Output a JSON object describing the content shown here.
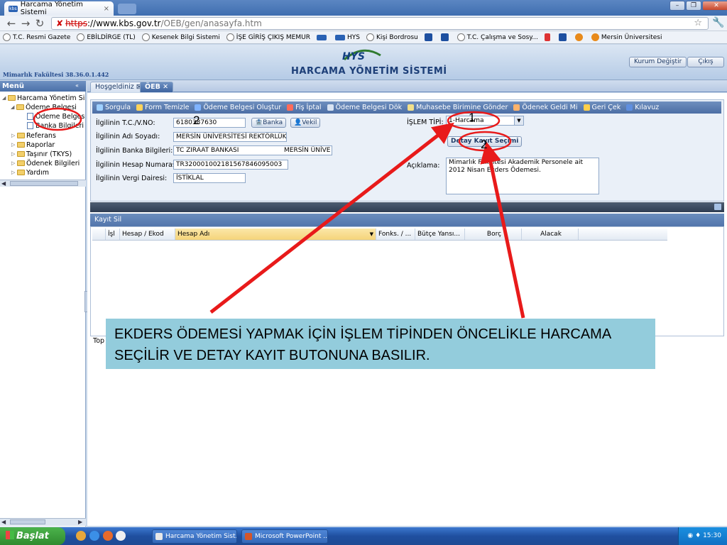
{
  "browser": {
    "tab_title": "Harcama Yönetim Sistemi",
    "tab_favicon": "kbs-favicon",
    "url_scheme": "https",
    "url_separator": "://",
    "url_host": "www.kbs.gov.tr",
    "url_path": "/OEB/gen/anasayfa.htm",
    "bookmarks": [
      {
        "label": "T.C. Resmi Gazete",
        "icon": "globe-icon"
      },
      {
        "label": "EBİLDİRGE (TL)",
        "icon": "globe-icon"
      },
      {
        "label": "Kesenek Bilgi Sistemi",
        "icon": "globe-icon"
      },
      {
        "label": "İŞE GİRİŞ ÇIKIŞ MEMUR",
        "icon": "globe-icon"
      },
      {
        "label": "",
        "icon": "kbs-icon"
      },
      {
        "label": "HYS",
        "icon": "kbs-icon"
      },
      {
        "label": "Kişi Bordrosu",
        "icon": "globe-icon"
      },
      {
        "label": "",
        "icon": "sgk-icon"
      },
      {
        "label": "",
        "icon": "link-icon"
      },
      {
        "label": "T.C. Çalışma ve Sosy...",
        "icon": "globe-icon"
      },
      {
        "label": "",
        "icon": "red-icon"
      },
      {
        "label": "",
        "icon": "blue-icon"
      },
      {
        "label": "",
        "icon": "orange-icon"
      },
      {
        "label": "Mersin Üniversitesi",
        "icon": "orange-icon"
      }
    ]
  },
  "header": {
    "faculty": "Mimarlık Fakültesi 38.36.0.1.442",
    "logo_text": "HYS",
    "system_title": "HARCAMA YÖNETİM SİSTEMİ",
    "change_institution": "Kurum Değiştir",
    "logout": "Çıkış"
  },
  "menu": {
    "title": "Menü",
    "items": [
      {
        "label": "Harcama Yönetim Sis"
      },
      {
        "label": "Ödeme Belgesi"
      },
      {
        "label": "Ödeme Belges"
      },
      {
        "label": "Banka Bilgileri"
      },
      {
        "label": "Referans"
      },
      {
        "label": "Raporlar"
      },
      {
        "label": "Taşınır (TKYS)"
      },
      {
        "label": "Ödenek Bilgileri"
      },
      {
        "label": "Yardım"
      }
    ]
  },
  "tabs": [
    {
      "label": "Hoşgeldiniz"
    },
    {
      "label": "ÖEB"
    }
  ],
  "actions": [
    {
      "label": "Sorgula",
      "icon": "search-icon",
      "color": "#9fd0ff"
    },
    {
      "label": "Form Temizle",
      "icon": "broom-icon",
      "color": "#ffd35a"
    },
    {
      "label": "Ödeme Belgesi Oluştur",
      "icon": "document-icon",
      "color": "#7fb3ff"
    },
    {
      "label": "Fiş İptal",
      "icon": "cancel-icon",
      "color": "#ff6b5a"
    },
    {
      "label": "Ödeme Belgesi Dök",
      "icon": "print-icon",
      "color": "#d8e3f2"
    },
    {
      "label": "Muhasebe Birimine Gönder",
      "icon": "send-icon",
      "color": "#f2e08a"
    },
    {
      "label": "Ödenek Geldi Mi",
      "icon": "headset-icon",
      "color": "#ffb36b"
    },
    {
      "label": "Geri Çek",
      "icon": "undo-icon",
      "color": "#ffcf4a"
    },
    {
      "label": "Kılavuz",
      "icon": "help-icon",
      "color": "#5f8fe0"
    }
  ],
  "form": {
    "tc_label": "İlgilinin T.C./V.NO:",
    "tc_value": "6180387630",
    "banka_btn": "Banka",
    "vekil_btn": "Vekil",
    "name_label": "İlgilinin Adı Soyadı:",
    "name_value": "MERSİN ÜNİVERSİTESİ REKTÖRLÜK",
    "bank_label": "İlgilinin Banka Bilgileri:",
    "bank_value": "TC ZIRAAT BANKASI",
    "bank_branch": "MERSİN ÜNİVE",
    "iban_label": "İlgilinin Hesap Numarası:",
    "iban_value": "TR320001002181567846095003",
    "tax_label": "İlgilinin Vergi Dairesi:",
    "tax_value": "İSTİKLAL",
    "islem_label": "İŞLEM TİPİ:",
    "islem_value": "1-Harcama",
    "detay_btn": "Detay Kayıt Seçimi",
    "aciklama_label": "Açıklama:",
    "aciklama_value": "Mimarlık Fakültesi Akademik Personele ait 2012 Nisan Ekders Ödemesi."
  },
  "grid": {
    "kayit_sil": "Kayıt Sil",
    "columns": [
      "İş",
      "İşl",
      "Hesap / Ekod",
      "Hesap Adı",
      "Fonks. / ...",
      "Bütçe Yansı...",
      "Borç",
      "Alacak"
    ],
    "footer": "Top"
  },
  "annotation": {
    "callout_text": "EKDERS ÖDEMESİ YAPMAK İÇİN İŞLEM TİPİNDEN ÖNCELİKLE HARCAMA SEÇİLİR VE DETAY KAYIT BUTONUNA BASILIR.",
    "num1": "1",
    "num2a": "2",
    "num2b": "2",
    "arrow_color": "#e81a1a",
    "circle_color": "#e81a1a"
  },
  "taskbar": {
    "start": "Başlat",
    "tasks": [
      {
        "label": "Harcama Yönetim Sist...",
        "icon": "chrome-icon"
      },
      {
        "label": "Microsoft PowerPoint ...",
        "icon": "powerpoint-icon"
      }
    ],
    "clock": "15:30"
  }
}
